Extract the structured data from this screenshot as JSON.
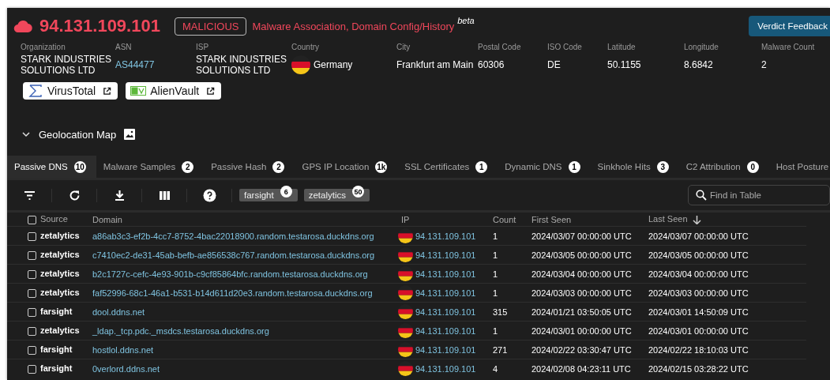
{
  "header": {
    "ip": "94.131.109.101",
    "verdict": "MALICIOUS",
    "reasons": "Malware Association, Domain Config/History",
    "beta": "beta",
    "feedback_button": "Verdict Feedback"
  },
  "info": [
    {
      "label": "Organization",
      "value": "STARK INDUSTRIES SOLUTIONS LTD",
      "kind": "text"
    },
    {
      "label": "ASN",
      "value": "AS44477",
      "kind": "link"
    },
    {
      "label": "ISP",
      "value": "STARK INDUSTRIES SOLUTIONS LTD",
      "kind": "text"
    },
    {
      "label": "Country",
      "value": "Germany",
      "kind": "country"
    },
    {
      "label": "City",
      "value": "Frankfurt am Main",
      "kind": "text"
    },
    {
      "label": "Postal Code",
      "value": "60306",
      "kind": "text"
    },
    {
      "label": "ISO Code",
      "value": "DE",
      "kind": "text"
    },
    {
      "label": "Latitude",
      "value": "50.1155",
      "kind": "text"
    },
    {
      "label": "Longitude",
      "value": "8.6842",
      "kind": "text"
    },
    {
      "label": "Malware Count",
      "value": "2",
      "kind": "text"
    }
  ],
  "external_links": [
    {
      "label": "VirusTotal",
      "kind": "virustotal"
    },
    {
      "label": "AlienVault",
      "kind": "alienvault"
    }
  ],
  "geolocation_map": {
    "label": "Geolocation Map",
    "expanded": false
  },
  "tabs": [
    {
      "label": "Passive DNS",
      "count": "10",
      "selected": true
    },
    {
      "label": "Malware Samples",
      "count": "2",
      "selected": false
    },
    {
      "label": "Passive Hash",
      "count": "2",
      "selected": false
    },
    {
      "label": "GPS IP Location",
      "count": "1k",
      "selected": false
    },
    {
      "label": "SSL Certificates",
      "count": "1",
      "selected": false
    },
    {
      "label": "Dynamic DNS",
      "count": "1",
      "selected": false
    },
    {
      "label": "Sinkhole Hits",
      "count": "3",
      "selected": false
    },
    {
      "label": "C2 Attribution",
      "count": "0",
      "selected": false
    },
    {
      "label": "Host Posture",
      "selected": false
    }
  ],
  "toolbar": {
    "source_chips": [
      {
        "label": "farsight",
        "count": "6"
      },
      {
        "label": "zetalytics",
        "count": "50"
      }
    ],
    "search": {
      "placeholder": "Find in Table"
    }
  },
  "table": {
    "select_all_checked": false,
    "columns": [
      {
        "label": "Source"
      },
      {
        "label": "Domain"
      },
      {
        "label": "IP"
      },
      {
        "label": "Count"
      },
      {
        "label": "First Seen"
      },
      {
        "label": "Last Seen",
        "sorted_descending": true
      }
    ],
    "rows": [
      {
        "checked": false,
        "source": "zetalytics",
        "domain": "a86ab3c3-ef2b-4cc7-8752-4bac22018900.random.testarosa.duckdns.org",
        "ip": "94.131.109.101",
        "count": "1",
        "first_seen": "2024/03/07 00:00:00 UTC",
        "last_seen": "2024/03/07 00:00:00 UTC"
      },
      {
        "checked": false,
        "source": "zetalytics",
        "domain": "c7410ec2-de31-45ab-befb-ae856538c767.random.testarosa.duckdns.org",
        "ip": "94.131.109.101",
        "count": "1",
        "first_seen": "2024/03/05 00:00:00 UTC",
        "last_seen": "2024/03/05 00:00:00 UTC"
      },
      {
        "checked": false,
        "source": "zetalytics",
        "domain": "b2c1727c-cefc-4e93-901b-c9cf85864bfc.random.testarosa.duckdns.org",
        "ip": "94.131.109.101",
        "count": "1",
        "first_seen": "2024/03/04 00:00:00 UTC",
        "last_seen": "2024/03/04 00:00:00 UTC"
      },
      {
        "checked": false,
        "source": "zetalytics",
        "domain": "faf52996-68c1-46a1-b531-b14d611d20e3.random.testarosa.duckdns.org",
        "ip": "94.131.109.101",
        "count": "1",
        "first_seen": "2024/03/03 00:00:00 UTC",
        "last_seen": "2024/03/03 00:00:00 UTC"
      },
      {
        "checked": false,
        "source": "farsight",
        "domain": "dool.ddns.net",
        "ip": "94.131.109.101",
        "count": "315",
        "first_seen": "2024/01/21 03:50:05 UTC",
        "last_seen": "2024/03/01 14:50:09 UTC"
      },
      {
        "checked": false,
        "source": "zetalytics",
        "domain": "_ldap._tcp.pdc._msdcs.testarosa.duckdns.org",
        "ip": "94.131.109.101",
        "count": "1",
        "first_seen": "2024/03/01 00:00:00 UTC",
        "last_seen": "2024/03/01 00:00:00 UTC"
      },
      {
        "checked": false,
        "source": "farsight",
        "domain": "hostlol.ddns.net",
        "ip": "94.131.109.101",
        "count": "271",
        "first_seen": "2024/02/22 03:30:47 UTC",
        "last_seen": "2024/02/22 18:10:03 UTC"
      },
      {
        "checked": false,
        "source": "farsight",
        "domain": "0verlord.ddns.net",
        "ip": "94.131.109.101",
        "count": "4",
        "first_seen": "2024/02/08 04:23:11 UTC",
        "last_seen": "2024/02/15 03:28:22 UTC"
      }
    ]
  }
}
